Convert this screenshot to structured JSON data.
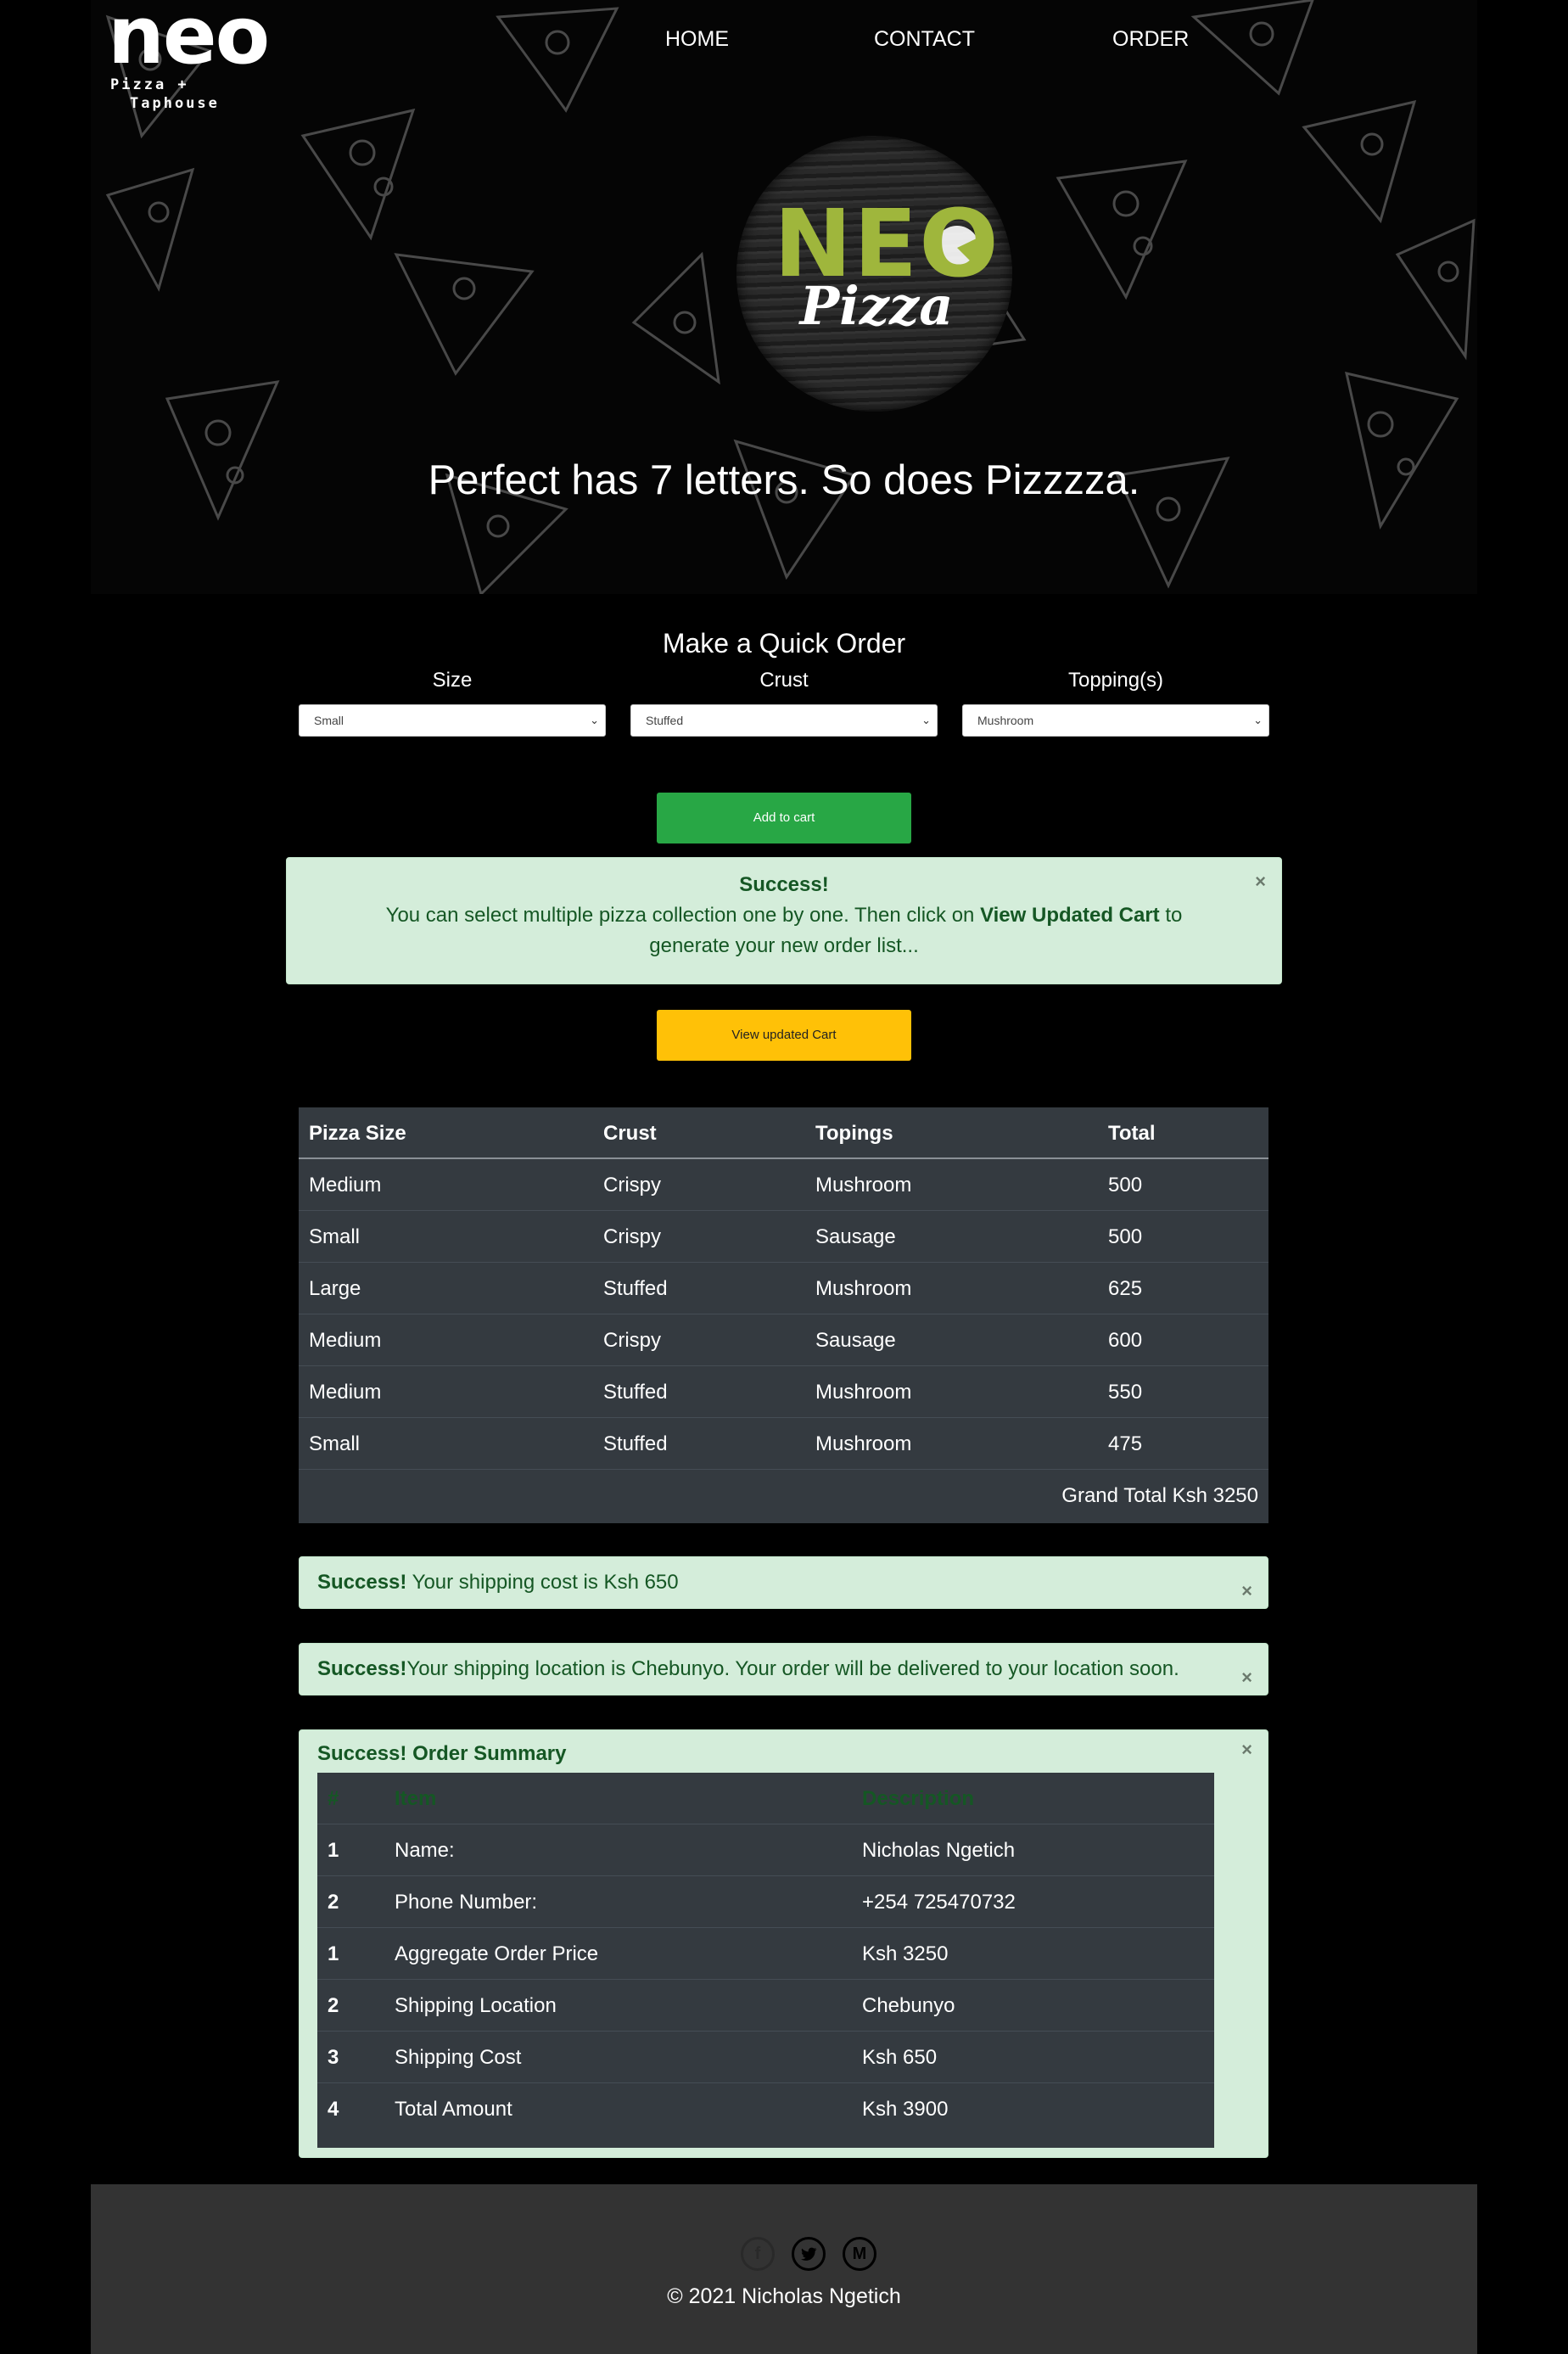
{
  "brand": {
    "logo_word": "neo",
    "logo_sub_line1": "Pizza +",
    "logo_sub_line2": "Taphouse",
    "badge_word": "NEO",
    "badge_sub": "Pizza"
  },
  "nav": {
    "home": "HOME",
    "contact": "CONTACT",
    "order": "ORDER"
  },
  "hero": {
    "tagline": "Perfect has 7 letters. So does Pizzzza."
  },
  "quick_order": {
    "title": "Make a Quick Order",
    "size_label": "Size",
    "crust_label": "Crust",
    "toppings_label": "Topping(s)",
    "size_value": "Small",
    "crust_value": "Stuffed",
    "toppings_value": "Mushroom",
    "add_to_cart": "Add to cart",
    "view_cart": "View updated Cart"
  },
  "info_alert": {
    "title": "Success!",
    "text_before": "You can select multiple pizza collection one by one. Then click on ",
    "text_bold": "View Updated Cart",
    "text_after": " to generate your new order list...",
    "close": "×"
  },
  "cart": {
    "headers": [
      "Pizza Size",
      "Crust",
      "Topings",
      "Total"
    ],
    "rows": [
      [
        "Medium",
        "Crispy",
        "Mushroom",
        "500"
      ],
      [
        "Small",
        "Crispy",
        "Sausage",
        "500"
      ],
      [
        "Large",
        "Stuffed",
        "Mushroom",
        "625"
      ],
      [
        "Medium",
        "Crispy",
        "Sausage",
        "600"
      ],
      [
        "Medium",
        "Stuffed",
        "Mushroom",
        "550"
      ],
      [
        "Small",
        "Stuffed",
        "Mushroom",
        "475"
      ]
    ],
    "grand_total": "Grand Total Ksh 3250"
  },
  "shipping_alert": {
    "bold": "Success!",
    "text": " Your shipping cost is Ksh 650",
    "close": "×"
  },
  "location_alert": {
    "bold": "Success!",
    "text": "Your shipping location is Chebunyo. Your order will be delivered to your location soon.",
    "close": "×"
  },
  "summary": {
    "title": "Success! Order Summary",
    "close": "×",
    "headers": [
      "#",
      "Item",
      "Description"
    ],
    "rows": [
      [
        "1",
        "Name:",
        "Nicholas Ngetich"
      ],
      [
        "2",
        "Phone Number:",
        "+254 725470732"
      ],
      [
        "1",
        "Aggregate Order Price",
        "Ksh 3250"
      ],
      [
        "2",
        "Shipping Location",
        "Chebunyo"
      ],
      [
        "3",
        "Shipping Cost",
        "Ksh 650"
      ],
      [
        "4",
        "Total Amount",
        "Ksh 3900"
      ]
    ]
  },
  "footer": {
    "icons": [
      "facebook-icon",
      "twitter-icon",
      "gmail-icon"
    ],
    "copyright": "© 2021 Nicholas Ngetich"
  },
  "colors": {
    "success_green": "#28a745",
    "warning_yellow": "#ffc107",
    "alert_bg": "#d4edda",
    "alert_text": "#155724",
    "table_dark": "#343a40",
    "footer_bg": "#333333",
    "badge_green": "#9fb63c"
  }
}
